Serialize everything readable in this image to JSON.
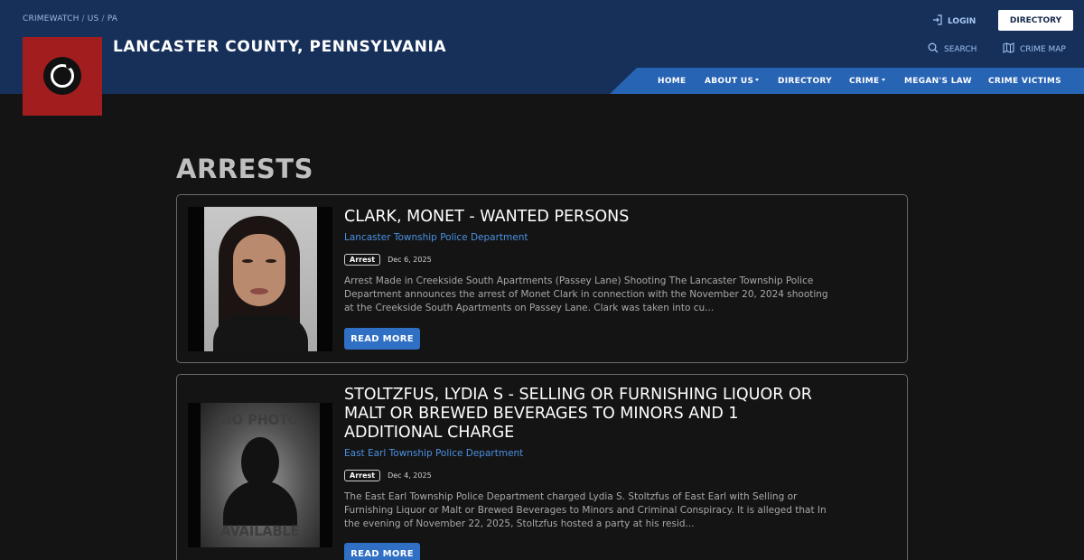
{
  "header": {
    "breadcrumb": [
      "CRIMEWATCH",
      "US",
      "PA"
    ],
    "site_title": "LANCASTER COUNTY, PENNSYLVANIA",
    "login_label": "LOGIN",
    "directory_button": "DIRECTORY",
    "search_label": "SEARCH",
    "crime_map_label": "CRIME MAP"
  },
  "nav": {
    "items": [
      {
        "label": "HOME"
      },
      {
        "label": "ABOUT US"
      },
      {
        "label": "DIRECTORY"
      },
      {
        "label": "CRIME"
      },
      {
        "label": "MEGAN'S LAW"
      },
      {
        "label": "CRIME VICTIMS"
      }
    ]
  },
  "page": {
    "heading": "ARRESTS"
  },
  "arrests": [
    {
      "title": "CLARK, MONET - WANTED PERSONS",
      "agency": "Lancaster Township Police Department",
      "badge": "Arrest",
      "date": "Dec 6, 2025",
      "summary": "Arrest Made in Creekside South Apartments (Passey Lane)  Shooting The Lancaster Township Police Department announces the arrest of Monet Clark in connection with the November 20, 2024 shooting at the Creekside South  Apartments on Passey Lane. Clark was taken into cu...",
      "read_more": "READ MORE"
    },
    {
      "title": "STOLTZFUS, LYDIA S - SELLING OR FURNISHING LIQUOR OR MALT OR BREWED BEVERAGES TO MINORS AND 1 ADDITIONAL CHARGE",
      "agency": "East Earl Township Police Department",
      "badge": "Arrest",
      "date": "Dec 4, 2025",
      "summary": "The East Earl Township Police Department charged Lydia S. Stoltzfus of East Earl with Selling or Furnishing Liquor or Malt or Brewed Beverages to Minors and Criminal Conspiracy.  It is alleged that In the evening of November 22, 2025, Stoltzfus hosted a party at his resid...",
      "read_more": "READ MORE",
      "photo_placeholder": {
        "top": "NO PHOTO",
        "bottom": "AVAILABLE"
      }
    }
  ]
}
